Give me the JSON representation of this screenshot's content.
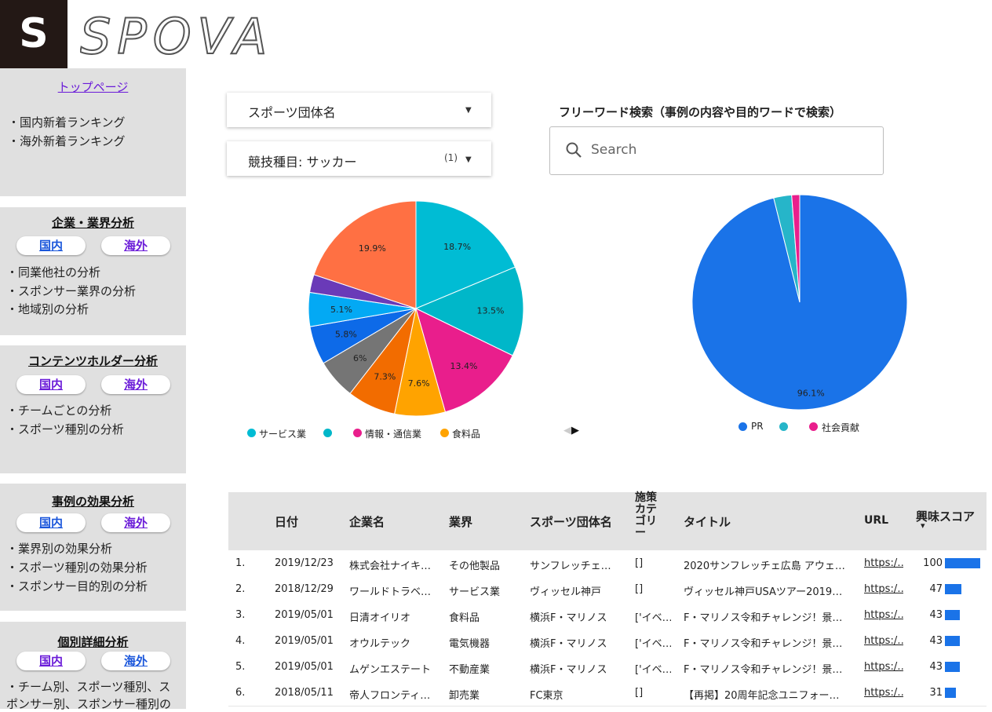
{
  "logo": {
    "letter": "S",
    "wordmark": "SPOVA"
  },
  "sidebar": {
    "top_link": "トップページ",
    "ranking_items": [
      "・国内新着ランキング",
      "・海外新着ランキング"
    ],
    "sections": [
      {
        "title": "企業・業界分析",
        "domestic": "国内",
        "overseas": "海外",
        "items": [
          "・同業他社の分析",
          "・スポンサー業界の分析",
          "・地域別の分析"
        ]
      },
      {
        "title": "コンテンツホルダー分析",
        "domestic": "国内",
        "overseas": "海外",
        "items": [
          "・チームごとの分析",
          "・スポーツ種別の分析"
        ]
      },
      {
        "title": "事例の効果分析",
        "domestic": "国内",
        "overseas": "海外",
        "items": [
          "・業界別の効果分析",
          "・スポーツ種別の効果分析",
          "・スポンサー目的別の分析"
        ]
      },
      {
        "title": "個別詳細分析",
        "domestic": "国内",
        "overseas": "海外",
        "items": [
          "・チーム別、スポーツ種別、ス",
          "ポンサー別、スポンサー種別の"
        ]
      }
    ]
  },
  "filters": {
    "org_dropdown": "スポーツ団体名",
    "sport_dropdown": "競技種目: サッカー",
    "sport_count": "(1)"
  },
  "search": {
    "title": "フリーワード検索（事例の内容や目的ワードで検索）",
    "placeholder": "Search"
  },
  "chart_data": [
    {
      "type": "pie",
      "slices": [
        {
          "label": "サービス業",
          "value": 18.7,
          "color": "#00bcd4",
          "label_text": "18.7%"
        },
        {
          "label": "",
          "value": 13.5,
          "color": "#00b7c9",
          "label_text": "13.5%"
        },
        {
          "label": "情報・通信業",
          "value": 13.4,
          "color": "#e91e8c",
          "label_text": "13.4%"
        },
        {
          "label": "食料品",
          "value": 7.6,
          "color": "#ffa300",
          "label_text": "7.6%"
        },
        {
          "label": "",
          "value": 7.3,
          "color": "#f26c00",
          "label_text": "7.3%"
        },
        {
          "label": "",
          "value": 6.0,
          "color": "#757575",
          "label_text": "6%"
        },
        {
          "label": "",
          "value": 5.8,
          "color": "#0d6ae8",
          "label_text": "5.8%"
        },
        {
          "label": "",
          "value": 5.1,
          "color": "#03a9f4",
          "label_text": "5.1%"
        },
        {
          "label": "",
          "value": 2.7,
          "color": "#6a3ab8",
          "label_text": ""
        },
        {
          "label": "",
          "value": 19.9,
          "color": "#ff7043",
          "label_text": "19.9%"
        }
      ],
      "legend": [
        {
          "label": "サービス業",
          "color": "#00bcd4"
        },
        {
          "label": "",
          "color": "#00b7c9"
        },
        {
          "label": "情報・通信業",
          "color": "#e91e8c"
        },
        {
          "label": "食料品",
          "color": "#ffa300"
        }
      ],
      "legend_pager": "◀ ▶"
    },
    {
      "type": "pie",
      "slices": [
        {
          "label": "PR",
          "value": 96.1,
          "color": "#1a73e8",
          "label_text": "96.1%"
        },
        {
          "label": "",
          "value": 2.7,
          "color": "#26b5c9",
          "label_text": ""
        },
        {
          "label": "社会貢献",
          "value": 1.2,
          "color": "#e91e8c",
          "label_text": ""
        }
      ],
      "legend": [
        {
          "label": "PR",
          "color": "#1a73e8"
        },
        {
          "label": "",
          "color": "#26b5c9"
        },
        {
          "label": "社会貢献",
          "color": "#e91e8c"
        }
      ]
    },
    {
      "type": "table",
      "headers": {
        "date": "日付",
        "company": "企業名",
        "industry": "業界",
        "org": "スポーツ団体名",
        "category": "施策カテゴリー",
        "title": "タイトル",
        "url": "URL",
        "score": "興味スコア",
        "sort_icon": "▾"
      },
      "rows": [
        {
          "no": "1.",
          "date": "2019/12/23",
          "company": "株式会社ナイキ…",
          "industry": "その他製品",
          "org": "サンフレッチェ…",
          "category": "[]",
          "title": "2020サンフレッチェ広島 アウェ…",
          "url": "https:/…",
          "score": 100
        },
        {
          "no": "2.",
          "date": "2018/12/29",
          "company": "ワールドトラベ…",
          "industry": "サービス業",
          "org": "ヴィッセル神戸",
          "category": "[]",
          "title": "ヴィッセル神戸USAツアー2019…",
          "url": "https:/…",
          "score": 47
        },
        {
          "no": "3.",
          "date": "2019/05/01",
          "company": "日清オイリオ",
          "industry": "食料品",
          "org": "横浜F・マリノス",
          "category": "['イベ…",
          "title": "F・マリノス令和チャレンジ！景…",
          "url": "https:/…",
          "score": 43
        },
        {
          "no": "4.",
          "date": "2019/05/01",
          "company": "オウルテック",
          "industry": "電気機器",
          "org": "横浜F・マリノス",
          "category": "['イベ…",
          "title": "F・マリノス令和チャレンジ！景…",
          "url": "https:/…",
          "score": 43
        },
        {
          "no": "5.",
          "date": "2019/05/01",
          "company": "ムゲンエステート",
          "industry": "不動産業",
          "org": "横浜F・マリノス",
          "category": "['イベ…",
          "title": "F・マリノス令和チャレンジ！景…",
          "url": "https:/…",
          "score": 43
        },
        {
          "no": "6.",
          "date": "2018/05/11",
          "company": "帝人フロンティ…",
          "industry": "卸売業",
          "org": "FC東京",
          "category": "[]",
          "title": "【再掲】20周年記念ユニフォー…",
          "url": "https:/…",
          "score": 31
        }
      ]
    }
  ]
}
